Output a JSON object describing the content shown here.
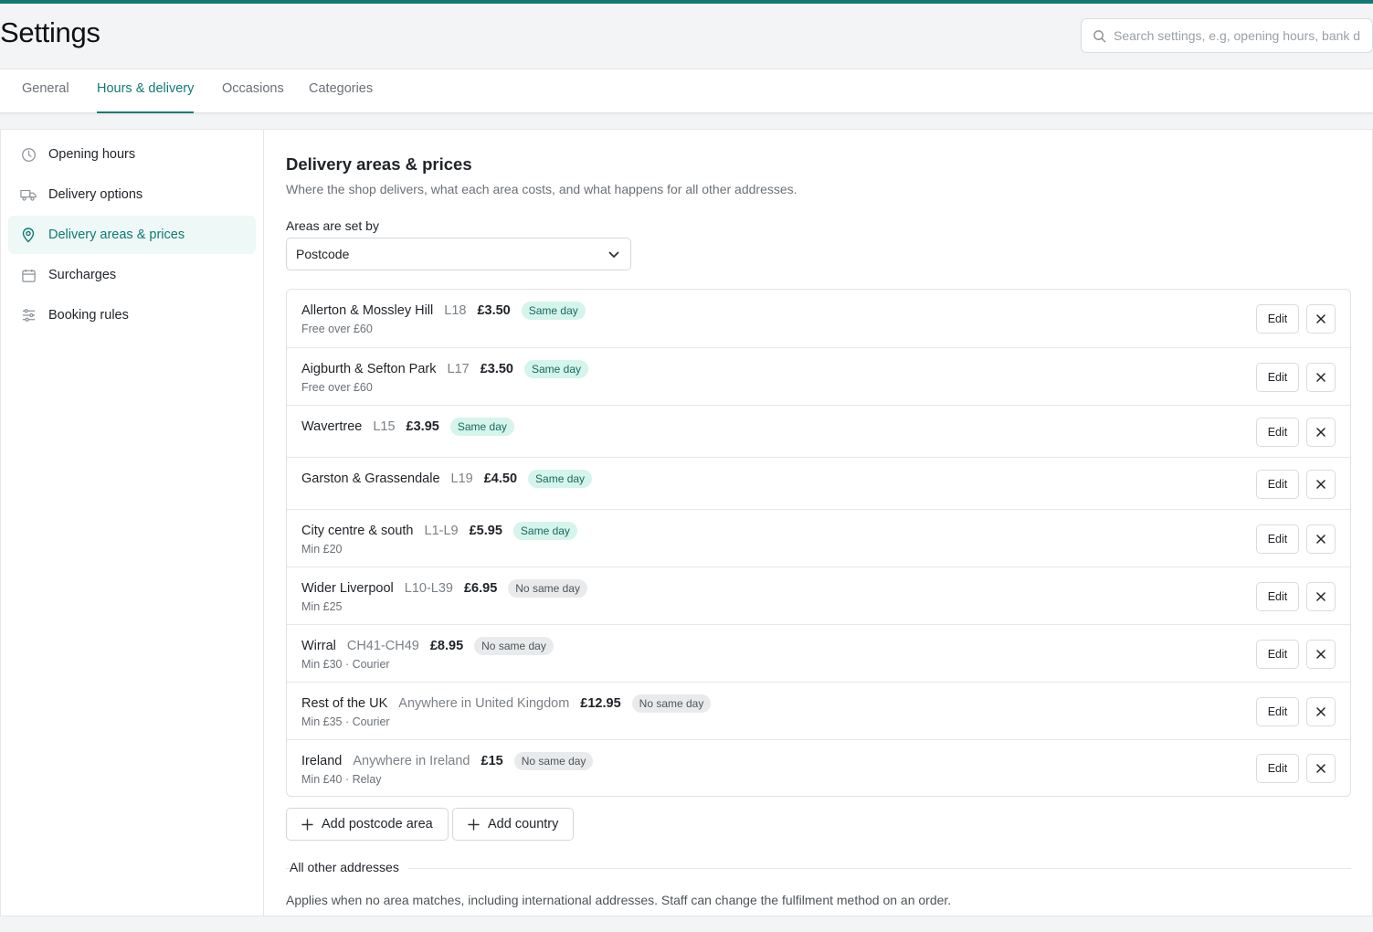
{
  "header": {
    "title": "Settings",
    "search_placeholder": "Search settings, e.g, opening hours, bank d"
  },
  "tabs": [
    {
      "label": "General"
    },
    {
      "label": "Hours & delivery"
    },
    {
      "label": "Occasions"
    },
    {
      "label": "Categories"
    }
  ],
  "sidebar": {
    "items": [
      {
        "label": "Opening hours",
        "icon": "clock-icon"
      },
      {
        "label": "Delivery options",
        "icon": "truck-icon"
      },
      {
        "label": "Delivery areas & prices",
        "icon": "map-pin-icon"
      },
      {
        "label": "Surcharges",
        "icon": "calendar-icon"
      },
      {
        "label": "Booking rules",
        "icon": "sliders-icon"
      }
    ],
    "active_index": 2
  },
  "section": {
    "title": "Delivery areas & prices",
    "description": "Where the shop delivers, what each area costs, and what happens for all other addresses.",
    "set_by_label": "Areas are set by",
    "set_by_value": "Postcode"
  },
  "areas": [
    {
      "name": "Allerton & Mossley Hill",
      "code": "L18",
      "price": "£3.50",
      "badge": "Same day",
      "same_day": true,
      "sub": "Free over £60"
    },
    {
      "name": "Aigburth & Sefton Park",
      "code": "L17",
      "price": "£3.50",
      "badge": "Same day",
      "same_day": true,
      "sub": "Free over £60"
    },
    {
      "name": "Wavertree",
      "code": "L15",
      "price": "£3.95",
      "badge": "Same day",
      "same_day": true,
      "sub": ""
    },
    {
      "name": "Garston & Grassendale",
      "code": "L19",
      "price": "£4.50",
      "badge": "Same day",
      "same_day": true,
      "sub": ""
    },
    {
      "name": "City centre & south",
      "code": "L1-L9",
      "price": "£5.95",
      "badge": "Same day",
      "same_day": true,
      "sub": "Min £20"
    },
    {
      "name": "Wider Liverpool",
      "code": "L10-L39",
      "price": "£6.95",
      "badge": "No same day",
      "same_day": false,
      "sub": "Min £25"
    },
    {
      "name": "Wirral",
      "code": "CH41-CH49",
      "price": "£8.95",
      "badge": "No same day",
      "same_day": false,
      "sub": "Min £30 · Courier"
    },
    {
      "name": "Rest of the UK",
      "code": "Anywhere in United Kingdom",
      "price": "£12.95",
      "badge": "No same day",
      "same_day": false,
      "sub": "Min £35 · Courier"
    },
    {
      "name": "Ireland",
      "code": "Anywhere in Ireland",
      "price": "£15",
      "badge": "No same day",
      "same_day": false,
      "sub": "Min £40 · Relay"
    }
  ],
  "row_actions": {
    "edit_label": "Edit"
  },
  "actions": {
    "add_postcode_label": "Add postcode area",
    "add_country_label": "Add country"
  },
  "other": {
    "label": "All other addresses",
    "description": "Applies when no area matches, including international addresses. Staff can change the fulfilment method on an order."
  },
  "colors": {
    "accent": "#0f7a73",
    "same_day_bg": "#d5f4ec",
    "no_same_day_bg": "#e8eaec"
  }
}
